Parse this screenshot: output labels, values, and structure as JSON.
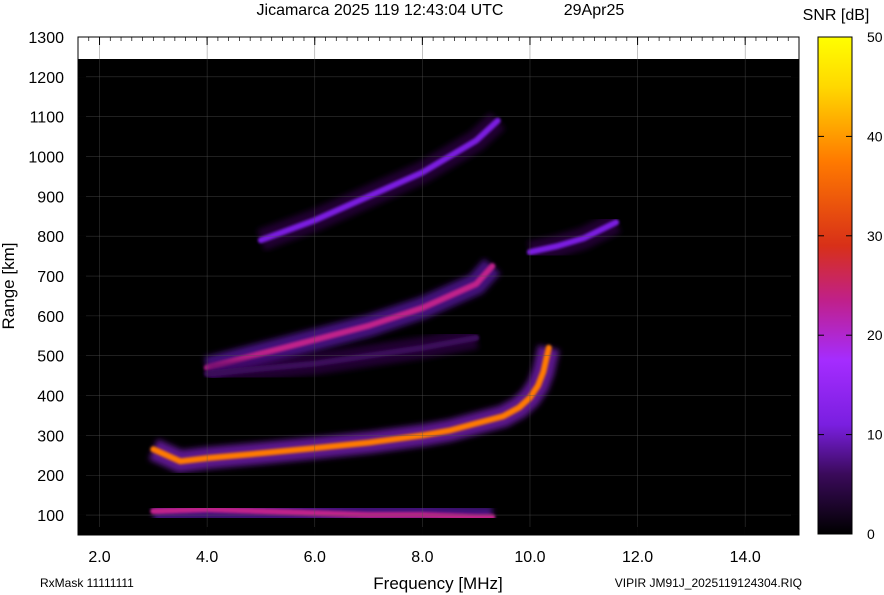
{
  "chart_data": {
    "type": "heatmap",
    "title": "Jicamarca 2025 119 12:43:04 UTC",
    "date_label": "29Apr25",
    "xlabel": "Frequency [MHz]",
    "ylabel": "Range [km]",
    "colorbar_label": "SNR [dB]",
    "xlim": [
      1.6,
      15.0
    ],
    "ylim": [
      50,
      1300
    ],
    "x_ticks": [
      2.0,
      4.0,
      6.0,
      8.0,
      10.0,
      12.0,
      14.0
    ],
    "x_tick_labels": [
      "2.0",
      "4.0",
      "6.0",
      "8.0",
      "10.0",
      "12.0",
      "14.0"
    ],
    "y_ticks": [
      100,
      200,
      300,
      400,
      500,
      600,
      700,
      800,
      900,
      1000,
      1100,
      1200,
      1300
    ],
    "y_tick_labels": [
      "100",
      "200",
      "300",
      "400",
      "500",
      "600",
      "700",
      "800",
      "900",
      "1000",
      "1100",
      "1200",
      "1300"
    ],
    "colorbar_range": [
      0,
      50
    ],
    "colorbar_ticks": [
      0,
      10,
      20,
      30,
      40,
      50
    ],
    "colorbar_tick_labels": [
      "0",
      "10",
      "20",
      "30",
      "40",
      "50"
    ],
    "colormap": [
      "#000000",
      "#3a0a5a",
      "#7a1fe0",
      "#a52cff",
      "#c0208a",
      "#d83018",
      "#ff7a00",
      "#ffd800",
      "#ffff00"
    ],
    "grid": true,
    "traces": [
      {
        "freq": [
          3.0,
          3.5,
          4.0,
          5.0,
          6.0,
          7.0,
          8.0,
          8.5,
          9.0,
          9.5,
          9.8,
          10.0,
          10.15,
          10.25,
          10.35
        ],
        "range": [
          265,
          235,
          243,
          255,
          268,
          282,
          300,
          312,
          330,
          348,
          370,
          395,
          425,
          460,
          520
        ],
        "snr": 40
      },
      {
        "freq": [
          3.0,
          4.0,
          5.0,
          6.0,
          7.0,
          8.0,
          9.0,
          9.3
        ],
        "range": [
          110,
          115,
          110,
          105,
          100,
          100,
          95,
          95
        ],
        "snr": 28
      },
      {
        "freq": [
          4.0,
          5.0,
          6.0,
          7.0,
          8.0,
          9.0,
          9.3
        ],
        "range": [
          470,
          505,
          540,
          575,
          620,
          680,
          725
        ],
        "snr": 25
      },
      {
        "freq": [
          5.0,
          6.0,
          7.0,
          8.0,
          9.0,
          9.4
        ],
        "range": [
          790,
          840,
          900,
          960,
          1040,
          1090
        ],
        "snr": 14
      },
      {
        "freq": [
          10.0,
          10.5,
          11.0,
          11.6
        ],
        "range": [
          760,
          775,
          795,
          835
        ],
        "snr": 12
      },
      {
        "freq": [
          4.0,
          6.0,
          8.0,
          9.0
        ],
        "range": [
          455,
          480,
          520,
          545
        ],
        "snr": 8
      }
    ]
  },
  "footer": {
    "rx_mask": "RxMask 11111111",
    "file": "VIPIR  JM91J_2025119124304.RIQ"
  }
}
